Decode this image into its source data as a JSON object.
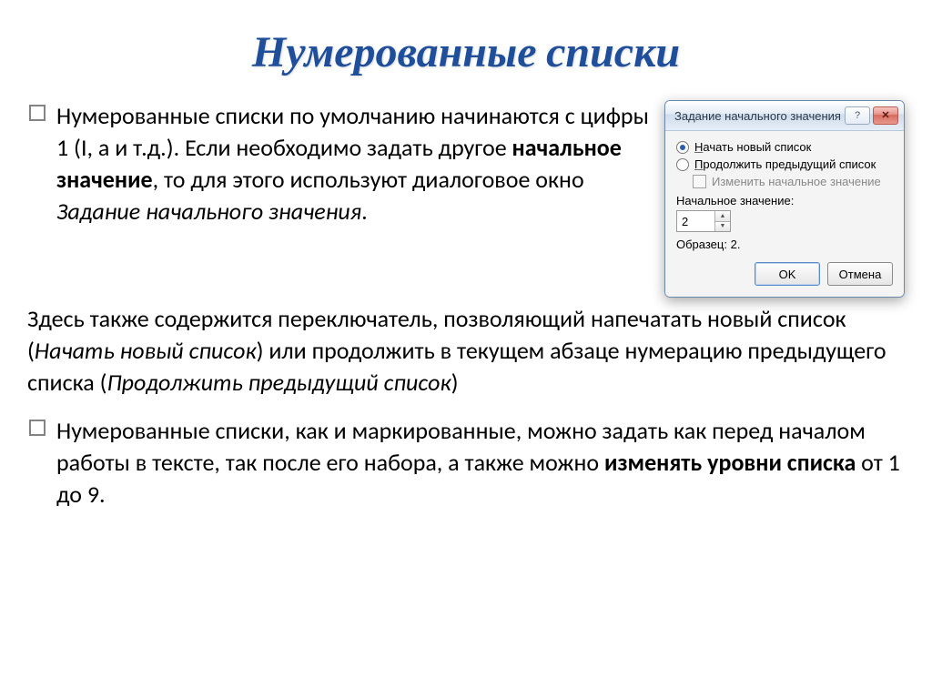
{
  "title": "Нумерованные списки",
  "para1": {
    "t1": "Нумерованные списки по умолчанию начинаются с цифры 1 (I, а и т.д.). Если необходимо задать другое ",
    "bold1": "начальное значение",
    "t2": ", то для этого используют диалоговое окно ",
    "italic1": "Задание начального значения",
    "t3": "."
  },
  "para2": {
    "t1": "Здесь  также содержится переключатель, позволяющий напечатать новый список (",
    "italic1": "Начать новый список",
    "t2": ") или продолжить в текущем абзаце нумерацию предыдущего списка (",
    "italic2": "Продолжить предыдущий список",
    "t3": ")"
  },
  "para3": {
    "t1": "Нумерованные списки, как и маркированные, можно задать как перед началом работы в тексте, так после его набора, а также можно ",
    "bold1": "изменять уровни списка",
    "t2": " от 1 до 9."
  },
  "dialog": {
    "title": "Задание начального значения",
    "radio1_prefix": "Н",
    "radio1_rest": "ачать новый список",
    "radio2_prefix": "П",
    "radio2_rest": "родолжить предыдущий список",
    "check_prefix": "И",
    "check_rest": "зменить начальное значение",
    "field_label_prefix": "Н",
    "field_label_rest": "ачальное значение:",
    "value": "2",
    "sample_label": "Образец: ",
    "sample_value": "2.",
    "ok": "OK",
    "cancel": "Отмена",
    "help": "?",
    "close": "✕"
  }
}
